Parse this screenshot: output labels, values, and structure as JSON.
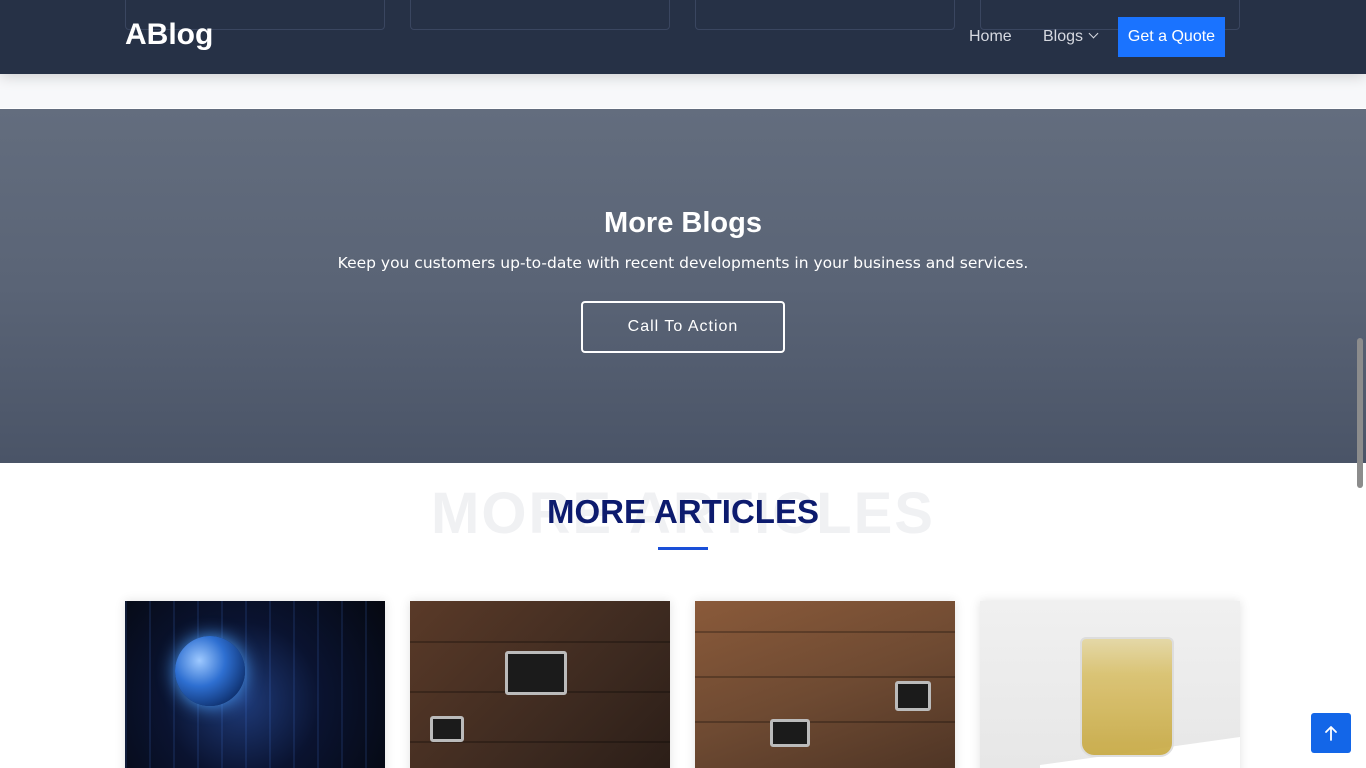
{
  "navbar": {
    "brand": "ABlog",
    "links": [
      {
        "label": "Home"
      },
      {
        "label": "Blogs"
      }
    ],
    "cta_label": "Get a Quote"
  },
  "cta_section": {
    "title": "More Blogs",
    "text": "Keep you customers up-to-date with recent developments in your business and services.",
    "button_label": "Call To Action"
  },
  "articles_section": {
    "background_title": "MORE ARTICLES",
    "title": "MORE ARTICLES"
  },
  "colors": {
    "navbar": "#263146",
    "accent_button": "#1a73ff",
    "section_title": "#0d1b6e",
    "back_to_top": "#1366e8"
  },
  "icons": {
    "blogs_dropdown": "chevron-down-icon",
    "back_to_top": "arrow-up-icon"
  }
}
